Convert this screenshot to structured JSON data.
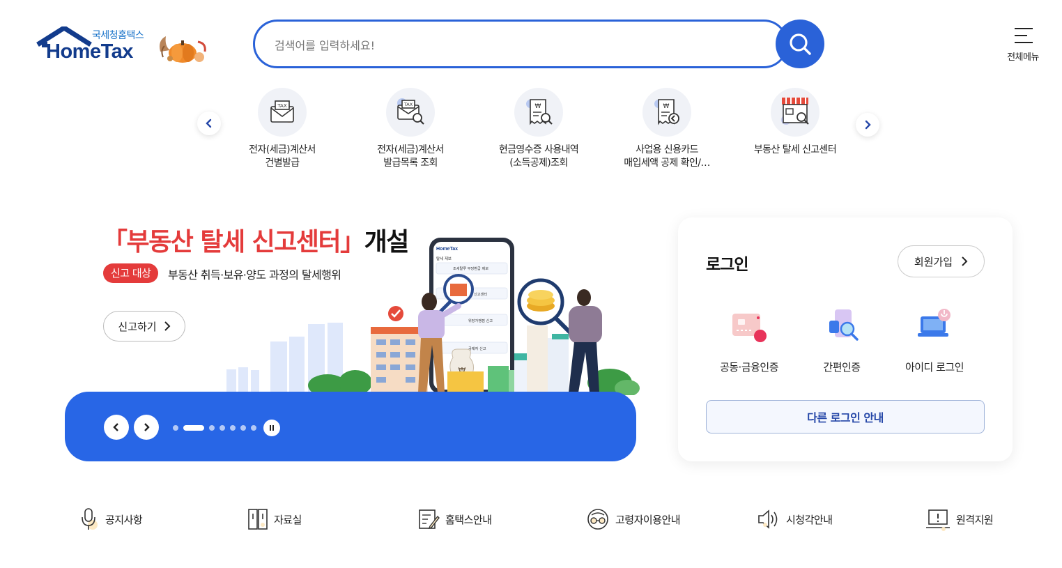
{
  "header": {
    "logo_sub": "국세청홈택스",
    "logo_main": "HomeTax",
    "search_placeholder": "검색어를 입력하세요!",
    "menu_label": "전체메뉴"
  },
  "quick_services": [
    {
      "label": "전자(세금)계산서\n건별발급",
      "icon": "tax-invoice-envelope-icon"
    },
    {
      "label": "전자(세금)계산서\n발급목록 조회",
      "icon": "tax-invoice-search-icon"
    },
    {
      "label": "현금영수증 사용내역\n(소득공제)조회",
      "icon": "cash-receipt-search-icon"
    },
    {
      "label": "사업용 신용카드\n매입세액 공제 확인/…",
      "icon": "business-card-receipt-icon"
    },
    {
      "label": "부동산 탈세 신고센터",
      "icon": "store-search-icon"
    }
  ],
  "banner": {
    "title_red": "「부동산 탈세 신고센터」",
    "title_black": "개설",
    "tag": "신고 대상",
    "description": "부동산 취득·보유·양도 과정의 탈세행위",
    "button_label": "신고하기",
    "slide_count": 7,
    "active_slide": 2
  },
  "phone_screen": {
    "brand": "HomeTax",
    "rows": [
      "탈세 제보",
      "조세탈루 부당환급 제보",
      "신고센터",
      "위장가맹점 신고",
      "공제자 신고"
    ]
  },
  "login": {
    "title": "로그인",
    "join_label": "회원가입",
    "options": [
      {
        "label": "공동·금융인증",
        "icon": "certificate-icon"
      },
      {
        "label": "간편인증",
        "icon": "simple-auth-icon"
      },
      {
        "label": "아이디 로그인",
        "icon": "id-login-icon"
      }
    ],
    "other_login": "다른 로그인 안내"
  },
  "bottom_links": [
    {
      "label": "공지사항",
      "icon": "microphone-icon"
    },
    {
      "label": "자료실",
      "icon": "archive-icon"
    },
    {
      "label": "홈택스안내",
      "icon": "guide-document-icon"
    },
    {
      "label": "고령자이용안내",
      "icon": "senior-glasses-icon"
    },
    {
      "label": "시청각안내",
      "icon": "speaker-icon"
    },
    {
      "label": "원격지원",
      "icon": "remote-support-icon"
    }
  ],
  "colors": {
    "primary": "#2866e6",
    "brand_navy": "#123b8c",
    "alert_red": "#e43b3b"
  }
}
